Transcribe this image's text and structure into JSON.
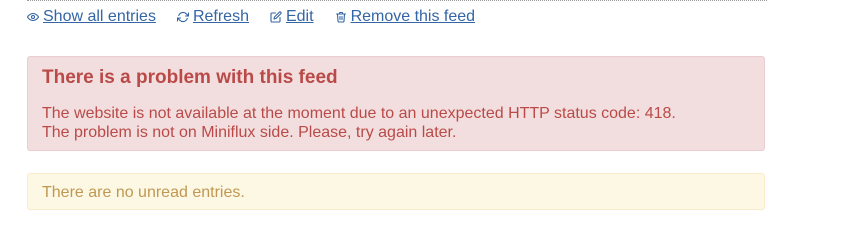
{
  "actions": {
    "show_all": "Show all entries",
    "refresh": "Refresh",
    "edit": "Edit",
    "remove": "Remove this feed"
  },
  "error_alert": {
    "title": "There is a problem with this feed",
    "line1": "The website is not available at the moment due to an unexpected HTTP status code: 418.",
    "line2": "The problem is not on Miniflux side. Please, try again later."
  },
  "info_alert": {
    "message": "There are no unread entries."
  },
  "icons": [
    "eye-icon",
    "refresh-icon",
    "edit-icon",
    "trash-icon"
  ],
  "colors": {
    "link": "#3465a4",
    "error_text": "#b94a48",
    "error_bg": "#f2dede",
    "info_text": "#c09853",
    "info_bg": "#fcf8e3"
  }
}
